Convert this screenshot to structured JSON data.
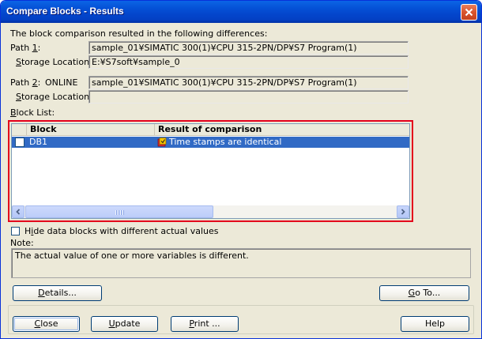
{
  "window": {
    "title": "Compare Blocks - Results"
  },
  "intro": "The block comparison resulted in the following differences:",
  "path1": {
    "label_prefix": "Path ",
    "label_key": "1",
    "label_suffix": ":",
    "value": "sample_01¥SIMATIC 300(1)¥CPU 315-2PN/DP¥S7 Program(1)",
    "storage_label_key": "S",
    "storage_label_rest": "torage Location:",
    "storage_value": "E:¥S7soft¥sample_0"
  },
  "path2": {
    "label_prefix": "Path ",
    "label_key": "2",
    "label_suffix": ":",
    "mode": "ONLINE",
    "value": "sample_01¥SIMATIC 300(1)¥CPU 315-2PN/DP¥S7 Program(1)",
    "storage_label_key": "S",
    "storage_label_rest": "torage Location:",
    "storage_value": ""
  },
  "block_list": {
    "label_key": "B",
    "label_rest": "lock List:",
    "columns": [
      "Block",
      "Result of comparison"
    ],
    "rows": [
      {
        "block": "DB1",
        "result": "Time stamps are identical",
        "selected": true,
        "checked": false
      }
    ]
  },
  "hide_option": {
    "label_prefix": "H",
    "label_key": "i",
    "label_rest": "de data blocks with different actual values",
    "checked": false
  },
  "note": {
    "label": "Note:",
    "text": "The actual value of one or more variables is different."
  },
  "buttons": {
    "details_key": "D",
    "details_rest": "etails...",
    "goto_key": "G",
    "goto_rest": "o To...",
    "close_key": "C",
    "close_rest": "lose",
    "update_key": "U",
    "update_rest": "pdate",
    "print_key": "P",
    "print_rest": "rint ...",
    "help": "Help"
  },
  "colors": {
    "title_bar": "#0346cc",
    "selection": "#316ac5",
    "highlight_outline": "#e3001b",
    "dialog_bg": "#ece9d8"
  },
  "icons": {
    "close": "close-icon",
    "result": "comparison-result-icon"
  }
}
